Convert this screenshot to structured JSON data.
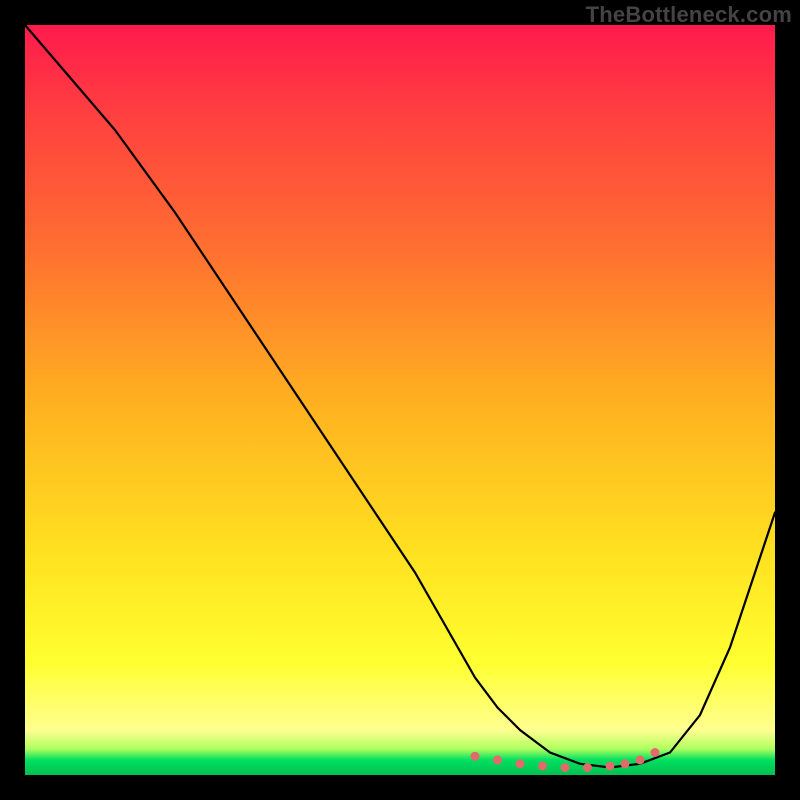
{
  "watermark": "TheBottleneck.com",
  "chart_data": {
    "type": "line",
    "title": "",
    "xlabel": "",
    "ylabel": "",
    "xlim": [
      0,
      100
    ],
    "ylim": [
      0,
      100
    ],
    "grid": false,
    "legend": "none",
    "series": [
      {
        "name": "main-curve",
        "x": [
          0,
          6,
          12,
          20,
          28,
          36,
          44,
          52,
          56,
          60,
          63,
          66,
          70,
          74,
          78,
          82,
          86,
          90,
          94,
          100
        ],
        "y": [
          100,
          93,
          86,
          75,
          63,
          51,
          39,
          27,
          20,
          13,
          9,
          6,
          3,
          1.5,
          1,
          1.5,
          3,
          8,
          17,
          35
        ]
      }
    ],
    "markers": {
      "name": "valley-dots",
      "color": "#e26a6a",
      "x": [
        60,
        63,
        66,
        69,
        72,
        75,
        78,
        80,
        82,
        84
      ],
      "y": [
        2.5,
        2,
        1.5,
        1.2,
        1,
        1,
        1.2,
        1.5,
        2,
        3
      ]
    },
    "background_gradient": {
      "stops": [
        {
          "pct": 0,
          "color": "#ff1a4d"
        },
        {
          "pct": 30,
          "color": "#ff7030"
        },
        {
          "pct": 70,
          "color": "#ffe020"
        },
        {
          "pct": 94,
          "color": "#ffff90"
        },
        {
          "pct": 100,
          "color": "#00c050"
        }
      ]
    }
  }
}
